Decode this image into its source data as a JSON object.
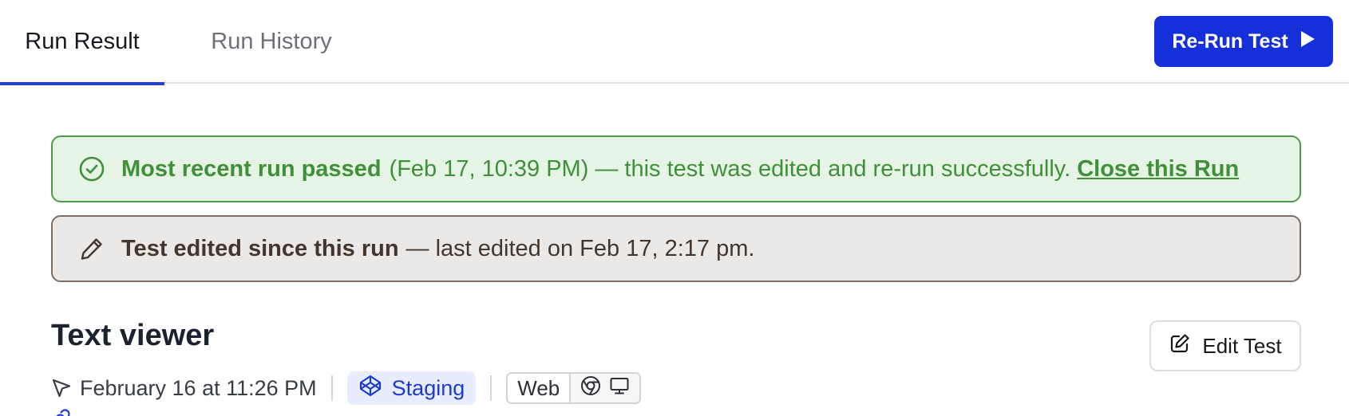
{
  "tabs": {
    "run_result": "Run Result",
    "run_history": "Run History",
    "active": "Run Result"
  },
  "header": {
    "rerun_label": "Re-Run Test"
  },
  "pass_banner": {
    "bold": "Most recent run passed",
    "timestamp": "(Feb 17, 10:39 PM)",
    "message": "— this test was edited and re-run successfully.",
    "link": "Close this Run"
  },
  "edit_banner": {
    "bold": "Test edited since this run",
    "message": "— last edited on Feb 17, 2:17 pm."
  },
  "test": {
    "title": "Text viewer",
    "edit_label": "Edit Test",
    "run_time": "February 16 at 11:26 PM",
    "environment": "Staging",
    "platform": "Web"
  },
  "icons": {
    "play": "play-icon",
    "pass": "check-circle-icon",
    "edit": "pencil-icon",
    "edit_test": "edit-square-icon",
    "run_time": "cursor-arrow-icon",
    "environment": "codepen-icon",
    "browser": "chrome-icon",
    "device": "monitor-icon",
    "url": "link-icon"
  },
  "colors": {
    "accent": "#1530d9",
    "pass_bg": "#e6f4e5",
    "pass_text": "#3f8f3b",
    "edit_bg": "#ebe9e7",
    "edit_text": "#43362c",
    "env_bg": "#e7edfc"
  }
}
